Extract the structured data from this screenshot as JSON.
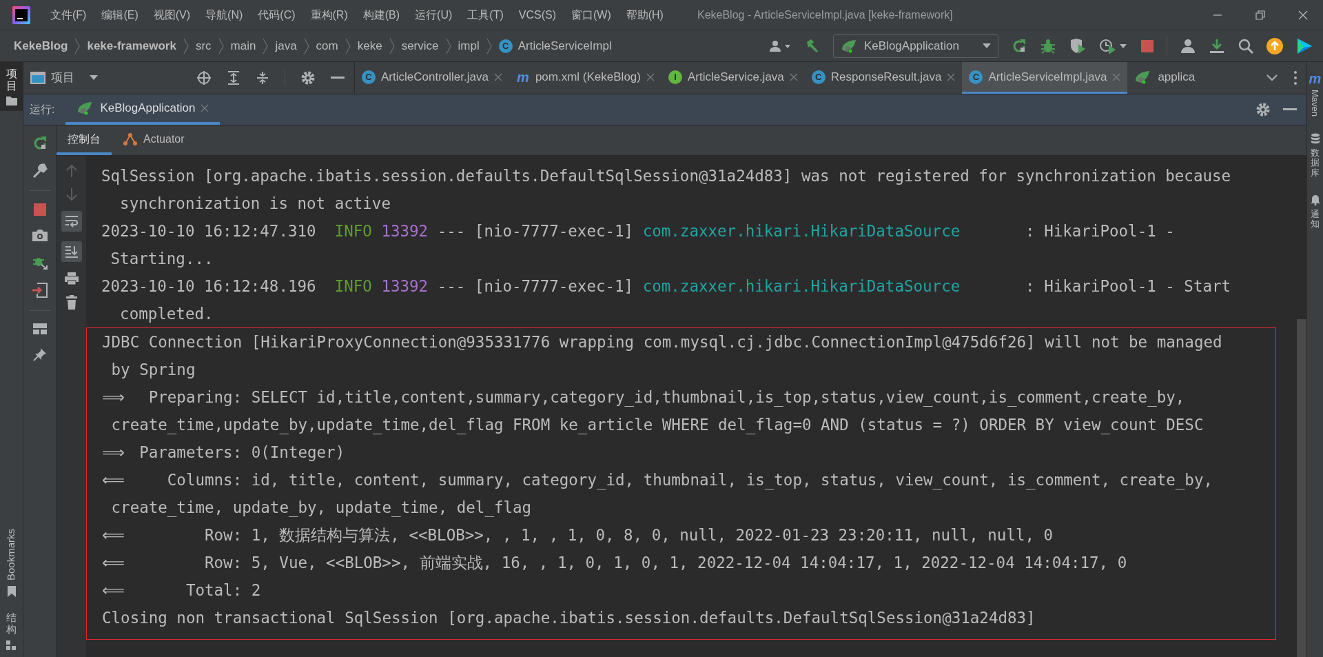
{
  "window": {
    "title": "KekeBlog - ArticleServiceImpl.java [keke-framework]"
  },
  "menu": [
    "文件(F)",
    "编辑(E)",
    "视图(V)",
    "导航(N)",
    "代码(C)",
    "重构(R)",
    "构建(B)",
    "运行(U)",
    "工具(T)",
    "VCS(S)",
    "窗口(W)",
    "帮助(H)"
  ],
  "breadcrumbs": [
    {
      "label": "KekeBlog",
      "bold": true
    },
    {
      "label": "keke-framework",
      "bold": true
    },
    {
      "label": "src",
      "bold": false
    },
    {
      "label": "main",
      "bold": false
    },
    {
      "label": "java",
      "bold": false
    },
    {
      "label": "com",
      "bold": false
    },
    {
      "label": "keke",
      "bold": false
    },
    {
      "label": "service",
      "bold": false
    },
    {
      "label": "impl",
      "bold": false
    },
    {
      "label": "ArticleServiceImpl",
      "bold": false,
      "badge": "C"
    }
  ],
  "run_config": {
    "label": "KeBlogApplication"
  },
  "project_panel": {
    "title": "项目"
  },
  "editor_tabs": [
    {
      "label": "ArticleController.java",
      "kind": "class",
      "badge": "C",
      "selected": false,
      "closable": true
    },
    {
      "label": "pom.xml (KekeBlog)",
      "kind": "maven",
      "badge": "m",
      "selected": false,
      "closable": true
    },
    {
      "label": "ArticleService.java",
      "kind": "interface",
      "badge": "I",
      "selected": false,
      "closable": true
    },
    {
      "label": "ResponseResult.java",
      "kind": "class",
      "badge": "C",
      "selected": false,
      "closable": true
    },
    {
      "label": "ArticleServiceImpl.java",
      "kind": "class",
      "badge": "C",
      "selected": true,
      "closable": true
    },
    {
      "label": "applica",
      "kind": "spring",
      "selected": false,
      "closable": false
    }
  ],
  "left_tool_windows": [
    {
      "label": "项目",
      "kind": "project",
      "selected": true
    }
  ],
  "left_tool_windows_bottom": [
    {
      "label": "Bookmarks",
      "kind": "bookmarks"
    },
    {
      "label": "结构",
      "kind": "structure"
    }
  ],
  "right_tool_windows": [
    {
      "label": "Maven",
      "kind": "maven",
      "badge": "m"
    },
    {
      "label": "数据库",
      "kind": "database"
    },
    {
      "label": "通知",
      "kind": "notifications"
    }
  ],
  "run_panel": {
    "label": "运行:",
    "tabs": [
      {
        "label": "KeBlogApplication",
        "selected": true
      }
    ],
    "subtabs": [
      {
        "label": "控制台",
        "kind": "console",
        "selected": true
      },
      {
        "label": "Actuator",
        "kind": "actuator",
        "selected": false
      }
    ]
  },
  "console_lines": [
    {
      "boxed": false,
      "segments": [
        {
          "kind": "plain",
          "text": "SqlSession [org.apache.ibatis.session.defaults.DefaultSqlSession@31a24d83] was not registered for synchronization because"
        }
      ]
    },
    {
      "boxed": false,
      "segments": [
        {
          "kind": "plain",
          "text": "  synchronization is not active"
        }
      ]
    },
    {
      "boxed": false,
      "segments": [
        {
          "kind": "plain",
          "text": "2023-10-10 16:12:47.310  "
        },
        {
          "kind": "level",
          "text": "INFO"
        },
        {
          "kind": "pid",
          "text": "13392"
        },
        {
          "kind": "plain",
          "text": " --- [nio-7777-exec-1] "
        },
        {
          "kind": "logger",
          "text": "com.zaxxer.hikari.HikariDataSource"
        },
        {
          "kind": "plain",
          "text": "       : HikariPool-1 -"
        }
      ]
    },
    {
      "boxed": false,
      "segments": [
        {
          "kind": "plain",
          "text": " Starting..."
        }
      ]
    },
    {
      "boxed": false,
      "segments": [
        {
          "kind": "plain",
          "text": "2023-10-10 16:12:48.196  "
        },
        {
          "kind": "level",
          "text": "INFO"
        },
        {
          "kind": "pid",
          "text": "13392"
        },
        {
          "kind": "plain",
          "text": " --- [nio-7777-exec-1] "
        },
        {
          "kind": "logger",
          "text": "com.zaxxer.hikari.HikariDataSource"
        },
        {
          "kind": "plain",
          "text": "       : HikariPool-1 - Start"
        }
      ]
    },
    {
      "boxed": false,
      "segments": [
        {
          "kind": "plain",
          "text": "  completed."
        }
      ]
    },
    {
      "boxed": true,
      "segments": [
        {
          "kind": "plain",
          "text": "JDBC Connection [HikariProxyConnection@935331776 wrapping com.mysql.cj.jdbc.ConnectionImpl@475d6f26] will not be managed"
        }
      ]
    },
    {
      "boxed": true,
      "segments": [
        {
          "kind": "plain",
          "text": " by Spring"
        }
      ]
    },
    {
      "boxed": true,
      "segments": [
        {
          "kind": "arrow",
          "text": "⟹"
        },
        {
          "kind": "plain",
          "text": "  Preparing: SELECT id,title,content,summary,category_id,thumbnail,is_top,status,view_count,is_comment,create_by,"
        }
      ]
    },
    {
      "boxed": true,
      "segments": [
        {
          "kind": "plain",
          "text": " create_time,update_by,update_time,del_flag FROM ke_article WHERE del_flag=0 AND (status = ?) ORDER BY view_count DESC"
        }
      ]
    },
    {
      "boxed": true,
      "segments": [
        {
          "kind": "arrow",
          "text": "⟹"
        },
        {
          "kind": "plain",
          "text": " Parameters: 0(Integer)"
        }
      ]
    },
    {
      "boxed": true,
      "segments": [
        {
          "kind": "arrow",
          "text": "⟸"
        },
        {
          "kind": "plain",
          "text": "    Columns: id, title, content, summary, category_id, thumbnail, is_top, status, view_count, is_comment, create_by,"
        }
      ]
    },
    {
      "boxed": true,
      "segments": [
        {
          "kind": "plain",
          "text": " create_time, update_by, update_time, del_flag"
        }
      ]
    },
    {
      "boxed": true,
      "segments": [
        {
          "kind": "arrow",
          "text": "⟸"
        },
        {
          "kind": "plain",
          "text": "        Row: 1, 数据结构与算法, <<BLOB>>, , 1, , 1, 0, 8, 0, null, 2022-01-23 23:20:11, null, null, 0"
        }
      ]
    },
    {
      "boxed": true,
      "segments": [
        {
          "kind": "arrow",
          "text": "⟸"
        },
        {
          "kind": "plain",
          "text": "        Row: 5, Vue, <<BLOB>>, 前端实战, 16, , 1, 0, 1, 0, 1, 2022-12-04 14:04:17, 1, 2022-12-04 14:04:17, 0"
        }
      ]
    },
    {
      "boxed": true,
      "segments": [
        {
          "kind": "arrow",
          "text": "⟸"
        },
        {
          "kind": "plain",
          "text": "      Total: 2"
        }
      ]
    },
    {
      "boxed": true,
      "segments": [
        {
          "kind": "plain",
          "text": "Closing non transactional SqlSession [org.apache.ibatis.session.defaults.DefaultSqlSession@31a24d83]"
        }
      ]
    }
  ]
}
